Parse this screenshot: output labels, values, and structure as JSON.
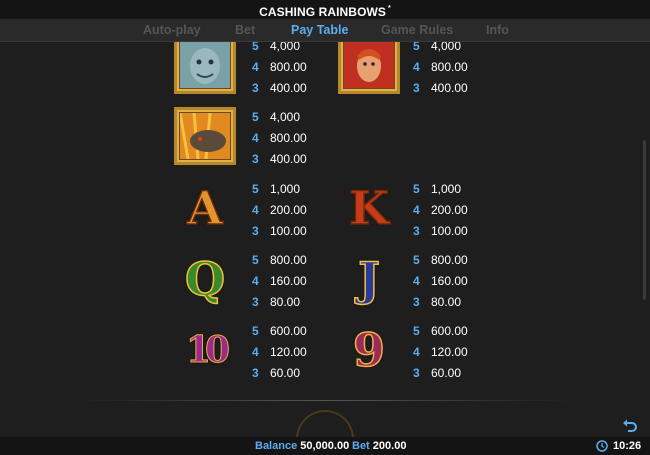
{
  "header": {
    "title": "CASHING RAINBOWS",
    "title_mark": "*"
  },
  "tabs": [
    {
      "label": "Auto-play",
      "active": false
    },
    {
      "label": "Bet",
      "active": false
    },
    {
      "label": "Pay Table",
      "active": true
    },
    {
      "label": "Game Rules",
      "active": false
    },
    {
      "label": "Info",
      "active": false
    }
  ],
  "paytable": [
    {
      "symbol": "leprechaun-grey",
      "pays": [
        {
          "count": "5",
          "amount": "4,000"
        },
        {
          "count": "4",
          "amount": "800.00"
        },
        {
          "count": "3",
          "amount": "400.00"
        }
      ]
    },
    {
      "symbol": "leprechaun-red",
      "pays": [
        {
          "count": "5",
          "amount": "4,000"
        },
        {
          "count": "4",
          "amount": "800.00"
        },
        {
          "count": "3",
          "amount": "400.00"
        }
      ]
    },
    {
      "symbol": "dragon",
      "pays": [
        {
          "count": "5",
          "amount": "4,000"
        },
        {
          "count": "4",
          "amount": "800.00"
        },
        {
          "count": "3",
          "amount": "400.00"
        }
      ]
    },
    {
      "symbol": "A",
      "pays": [
        {
          "count": "5",
          "amount": "1,000"
        },
        {
          "count": "4",
          "amount": "200.00"
        },
        {
          "count": "3",
          "amount": "100.00"
        }
      ]
    },
    {
      "symbol": "K",
      "pays": [
        {
          "count": "5",
          "amount": "1,000"
        },
        {
          "count": "4",
          "amount": "200.00"
        },
        {
          "count": "3",
          "amount": "100.00"
        }
      ]
    },
    {
      "symbol": "Q",
      "pays": [
        {
          "count": "5",
          "amount": "800.00"
        },
        {
          "count": "4",
          "amount": "160.00"
        },
        {
          "count": "3",
          "amount": "80.00"
        }
      ]
    },
    {
      "symbol": "J",
      "pays": [
        {
          "count": "5",
          "amount": "800.00"
        },
        {
          "count": "4",
          "amount": "160.00"
        },
        {
          "count": "3",
          "amount": "80.00"
        }
      ]
    },
    {
      "symbol": "10",
      "pays": [
        {
          "count": "5",
          "amount": "600.00"
        },
        {
          "count": "4",
          "amount": "120.00"
        },
        {
          "count": "3",
          "amount": "60.00"
        }
      ]
    },
    {
      "symbol": "9",
      "pays": [
        {
          "count": "5",
          "amount": "600.00"
        },
        {
          "count": "4",
          "amount": "120.00"
        },
        {
          "count": "3",
          "amount": "60.00"
        }
      ]
    }
  ],
  "footer": {
    "balance_label": "Balance",
    "balance_value": "50,000.00",
    "bet_label": "Bet",
    "bet_value": "200.00",
    "time": "10:26"
  },
  "colors": {
    "accent": "#5aaef0",
    "background": "#1e1e1e",
    "gold": "#b8862b"
  },
  "icons": {
    "back": "undo-arrow-icon",
    "clock": "clock-icon"
  }
}
